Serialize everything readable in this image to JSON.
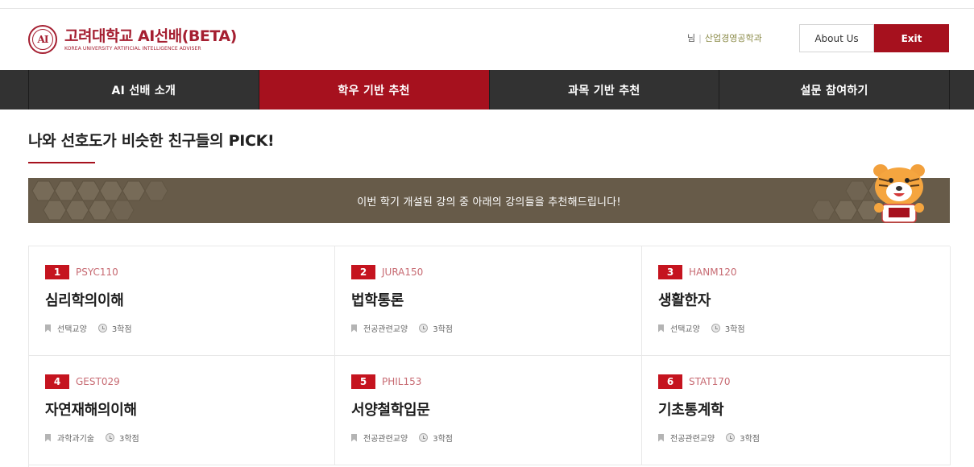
{
  "header": {
    "logo_mark": "AI",
    "logo_title": "고려대학교 AI선배(BETA)",
    "logo_subtitle": "KOREA UNIVERSITY ARTIFICIAL INTELLIGENCE ADVISER",
    "user_suffix": "님",
    "department": "산업경영공학과",
    "about_label": "About Us",
    "exit_label": "Exit"
  },
  "nav": {
    "items": [
      {
        "label": "AI 선배 소개",
        "active": false
      },
      {
        "label": "학우 기반 추천",
        "active": true
      },
      {
        "label": "과목 기반 추천",
        "active": false
      },
      {
        "label": "설문 참여하기",
        "active": false
      }
    ]
  },
  "page": {
    "title": "나와 선호도가 비슷한 친구들의 PICK!",
    "banner_text": "이번 학기 개설된 강의 중 아래의 강의들을 추천해드립니다!"
  },
  "courses": [
    {
      "rank": "1",
      "code": "PSYC110",
      "name": "심리학의이해",
      "category": "선택교양",
      "credits": "3학점"
    },
    {
      "rank": "2",
      "code": "JURA150",
      "name": "법학통론",
      "category": "전공관련교양",
      "credits": "3학점"
    },
    {
      "rank": "3",
      "code": "HANM120",
      "name": "생활한자",
      "category": "선택교양",
      "credits": "3학점"
    },
    {
      "rank": "4",
      "code": "GEST029",
      "name": "자연재해의이해",
      "category": "과학과기술",
      "credits": "3학점"
    },
    {
      "rank": "5",
      "code": "PHIL153",
      "name": "서양철학입문",
      "category": "전공관련교양",
      "credits": "3학점"
    },
    {
      "rank": "6",
      "code": "STAT170",
      "name": "기초통계학",
      "category": "전공관련교양",
      "credits": "3학점"
    }
  ],
  "colors": {
    "brand": "#a6111e",
    "nav_bg": "#323232",
    "banner_bg": "#675b49",
    "code_text": "#c76a72"
  }
}
